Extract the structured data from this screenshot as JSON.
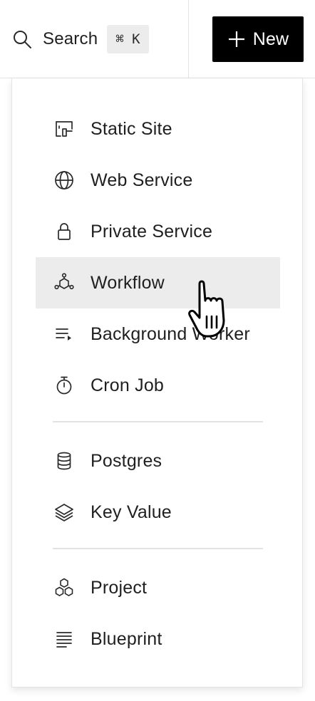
{
  "header": {
    "search_label": "Search",
    "search_shortcut": "⌘ K",
    "new_button_label": "New"
  },
  "menu": {
    "groups": [
      {
        "items": [
          {
            "label": "Static Site",
            "icon": "static-site-icon"
          },
          {
            "label": "Web Service",
            "icon": "globe-icon"
          },
          {
            "label": "Private Service",
            "icon": "lock-icon"
          },
          {
            "label": "Workflow",
            "icon": "workflow-icon",
            "highlighted": true
          },
          {
            "label": "Background Worker",
            "icon": "background-worker-icon"
          },
          {
            "label": "Cron Job",
            "icon": "stopwatch-icon"
          }
        ]
      },
      {
        "items": [
          {
            "label": "Postgres",
            "icon": "database-icon"
          },
          {
            "label": "Key Value",
            "icon": "layers-icon"
          }
        ]
      },
      {
        "items": [
          {
            "label": "Project",
            "icon": "project-icon"
          },
          {
            "label": "Blueprint",
            "icon": "blueprint-icon"
          }
        ]
      }
    ]
  },
  "colors": {
    "new_button_bg": "#000000",
    "highlight_bg": "#ececec",
    "text": "#1f1f1f"
  }
}
